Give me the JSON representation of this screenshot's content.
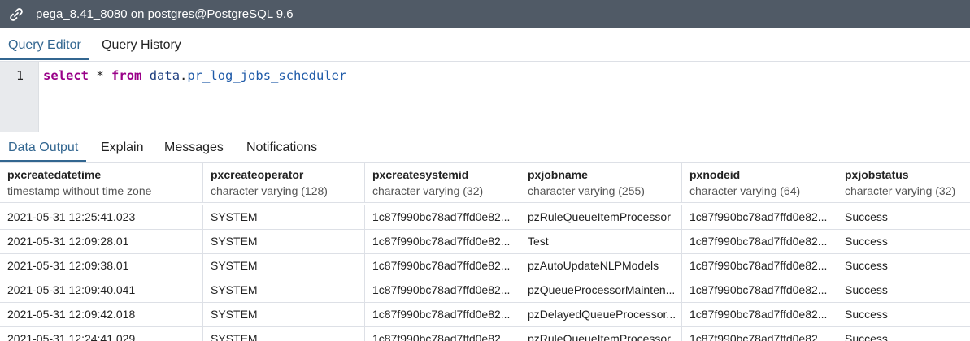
{
  "titlebar": {
    "icon": "connection-link-icon",
    "title": "pega_8.41_8080 on postgres@PostgreSQL 9.6"
  },
  "top_tabs": [
    "Query Editor",
    "Query History"
  ],
  "editor": {
    "line_number": "1",
    "query": {
      "kw_select": "select",
      "star": "*",
      "kw_from": "from",
      "schema": "data",
      "dot": ".",
      "table": "pr_log_jobs_scheduler"
    }
  },
  "output_tabs": [
    "Data Output",
    "Explain",
    "Messages",
    "Notifications"
  ],
  "grid": {
    "columns": [
      {
        "name": "pxcreatedatetime",
        "type": "timestamp without time zone"
      },
      {
        "name": "pxcreateoperator",
        "type": "character varying (128)"
      },
      {
        "name": "pxcreatesystemid",
        "type": "character varying (32)"
      },
      {
        "name": "pxjobname",
        "type": "character varying (255)"
      },
      {
        "name": "pxnodeid",
        "type": "character varying (64)"
      },
      {
        "name": "pxjobstatus",
        "type": "character varying (32)"
      }
    ],
    "rows": [
      [
        "2021-05-31 12:25:41.023",
        "SYSTEM",
        "1c87f990bc78ad7ffd0e82...",
        "pzRuleQueueItemProcessor",
        "1c87f990bc78ad7ffd0e82...",
        "Success"
      ],
      [
        "2021-05-31 12:09:28.01",
        "SYSTEM",
        "1c87f990bc78ad7ffd0e82...",
        "Test",
        "1c87f990bc78ad7ffd0e82...",
        "Success"
      ],
      [
        "2021-05-31 12:09:38.01",
        "SYSTEM",
        "1c87f990bc78ad7ffd0e82...",
        "pzAutoUpdateNLPModels",
        "1c87f990bc78ad7ffd0e82...",
        "Success"
      ],
      [
        "2021-05-31 12:09:40.041",
        "SYSTEM",
        "1c87f990bc78ad7ffd0e82...",
        "pzQueueProcessorMainten...",
        "1c87f990bc78ad7ffd0e82...",
        "Success"
      ],
      [
        "2021-05-31 12:09:42.018",
        "SYSTEM",
        "1c87f990bc78ad7ffd0e82...",
        "pzDelayedQueueProcessor...",
        "1c87f990bc78ad7ffd0e82...",
        "Success"
      ],
      [
        "2021-05-31 12:24:41.029",
        "SYSTEM",
        "1c87f990bc78ad7ffd0e82...",
        "pzRuleQueueItemProcessor",
        "1c87f990bc78ad7ffd0e82...",
        "Success"
      ]
    ]
  },
  "colors": {
    "titlebar_bg": "#505a66",
    "accent": "#326690",
    "border": "#dde0e6"
  }
}
